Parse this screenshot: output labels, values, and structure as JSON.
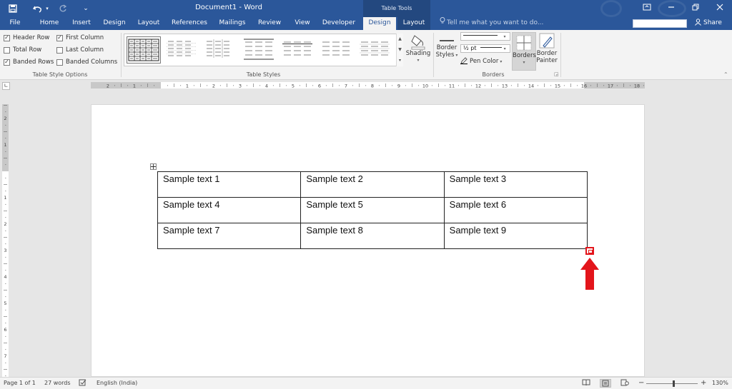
{
  "window": {
    "title": "Document1 - Word",
    "context_tab_group": "Table Tools"
  },
  "qat": {
    "undo_caret": "▾",
    "customize": "⌄"
  },
  "tabs": [
    {
      "label": "File"
    },
    {
      "label": "Home"
    },
    {
      "label": "Insert"
    },
    {
      "label": "Design"
    },
    {
      "label": "Layout"
    },
    {
      "label": "References"
    },
    {
      "label": "Mailings"
    },
    {
      "label": "Review"
    },
    {
      "label": "View"
    },
    {
      "label": "Developer"
    },
    {
      "label": "Design"
    },
    {
      "label": "Layout"
    }
  ],
  "tell_me": {
    "placeholder": "Tell me what you want to do..."
  },
  "share_label": "Share",
  "ribbon": {
    "style_options": {
      "header_row": {
        "label": "Header Row",
        "checked": true
      },
      "first_column": {
        "label": "First Column",
        "checked": true
      },
      "total_row": {
        "label": "Total Row",
        "checked": false
      },
      "last_column": {
        "label": "Last Column",
        "checked": false
      },
      "banded_rows": {
        "label": "Banded Rows",
        "checked": true
      },
      "banded_columns": {
        "label": "Banded Columns",
        "checked": false
      },
      "group_label": "Table Style Options"
    },
    "table_styles": {
      "group_label": "Table Styles"
    },
    "shading": {
      "label": "Shading"
    },
    "borders": {
      "border_styles_label_1": "Border",
      "border_styles_label_2": "Styles",
      "weight": "½ pt",
      "pen_color_label": "Pen Color",
      "borders_label": "Borders",
      "border_painter_label_1": "Border",
      "border_painter_label_2": "Painter",
      "group_label": "Borders"
    }
  },
  "ruler": {
    "h_labels": [
      "2",
      "1",
      "1",
      "2",
      "3",
      "4",
      "5",
      "6",
      "7",
      "8",
      "9",
      "10",
      "11",
      "12",
      "13",
      "14",
      "15",
      "16",
      "17",
      "18"
    ],
    "v_labels": [
      "2",
      "1",
      "1",
      "2",
      "3",
      "4",
      "5",
      "6",
      "7"
    ]
  },
  "document": {
    "table": [
      [
        "Sample text 1",
        "Sample text 2",
        "Sample text 3"
      ],
      [
        "Sample text 4",
        "Sample text 5",
        "Sample text 6"
      ],
      [
        "Sample text 7",
        "Sample text 8",
        "Sample text 9"
      ]
    ]
  },
  "status": {
    "page": "Page 1 of 1",
    "words": "27 words",
    "language": "English (India)",
    "zoom": "130%",
    "zoom_minus": "−",
    "zoom_plus": "+"
  },
  "colors": {
    "ribbon_blue": "#2b579a",
    "annotation_red": "#e3151b"
  }
}
